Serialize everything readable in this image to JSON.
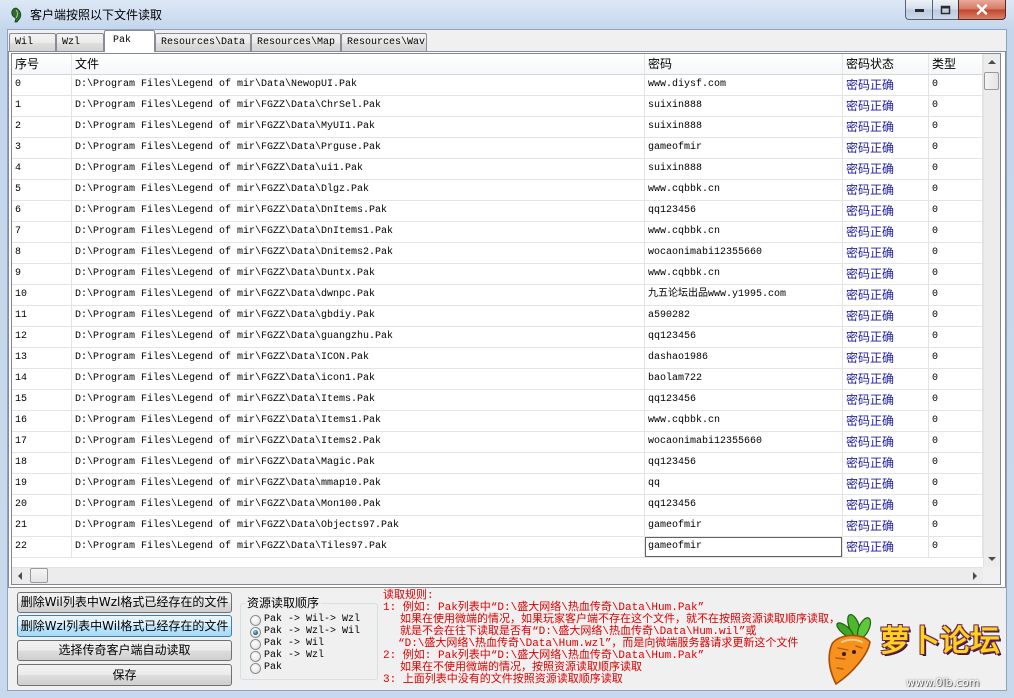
{
  "window": {
    "title": "客户端按照以下文件读取",
    "icons": {
      "app": "app-icon",
      "minimize": "minimize-icon",
      "maximize": "maximize-icon",
      "close": "close-icon"
    }
  },
  "tabs": [
    {
      "label": "Wil",
      "selected": false
    },
    {
      "label": "Wzl",
      "selected": false
    },
    {
      "label": "Pak",
      "selected": true
    },
    {
      "label": "Resources\\Data",
      "selected": false
    },
    {
      "label": "Resources\\Map",
      "selected": false
    },
    {
      "label": "Resources\\Wav",
      "selected": false
    }
  ],
  "table": {
    "columns": [
      "序号",
      "文件",
      "密码",
      "密码状态",
      "类型"
    ],
    "focused_cell": {
      "row": 22,
      "column": "password"
    },
    "rows": [
      {
        "index": "0",
        "file": "D:\\Program Files\\Legend of mir\\Data\\NewopUI.Pak",
        "password": "www.diysf.com",
        "status": "密码正确",
        "type": "0"
      },
      {
        "index": "1",
        "file": "D:\\Program Files\\Legend of mir\\FGZZ\\Data\\ChrSel.Pak",
        "password": "suixin888",
        "status": "密码正确",
        "type": "0"
      },
      {
        "index": "2",
        "file": "D:\\Program Files\\Legend of mir\\FGZZ\\Data\\MyUI1.Pak",
        "password": "suixin888",
        "status": "密码正确",
        "type": "0"
      },
      {
        "index": "3",
        "file": "D:\\Program Files\\Legend of mir\\FGZZ\\Data\\Prguse.Pak",
        "password": "gameofmir",
        "status": "密码正确",
        "type": "0"
      },
      {
        "index": "4",
        "file": "D:\\Program Files\\Legend of mir\\FGZZ\\Data\\ui1.Pak",
        "password": "suixin888",
        "status": "密码正确",
        "type": "0"
      },
      {
        "index": "5",
        "file": "D:\\Program Files\\Legend of mir\\FGZZ\\Data\\Dlgz.Pak",
        "password": "www.cqbbk.cn",
        "status": "密码正确",
        "type": "0"
      },
      {
        "index": "6",
        "file": "D:\\Program Files\\Legend of mir\\FGZZ\\Data\\DnItems.Pak",
        "password": "qq123456",
        "status": "密码正确",
        "type": "0"
      },
      {
        "index": "7",
        "file": "D:\\Program Files\\Legend of mir\\FGZZ\\Data\\DnItems1.Pak",
        "password": "www.cqbbk.cn",
        "status": "密码正确",
        "type": "0"
      },
      {
        "index": "8",
        "file": "D:\\Program Files\\Legend of mir\\FGZZ\\Data\\Dnitems2.Pak",
        "password": "wocaonimabi12355660",
        "status": "密码正确",
        "type": "0"
      },
      {
        "index": "9",
        "file": "D:\\Program Files\\Legend of mir\\FGZZ\\Data\\Duntx.Pak",
        "password": "www.cqbbk.cn",
        "status": "密码正确",
        "type": "0"
      },
      {
        "index": "10",
        "file": "D:\\Program Files\\Legend of mir\\FGZZ\\Data\\dwnpc.Pak",
        "password": "九五论坛出品www.y1995.com",
        "status": "密码正确",
        "type": "0"
      },
      {
        "index": "11",
        "file": "D:\\Program Files\\Legend of mir\\FGZZ\\Data\\gbdiy.Pak",
        "password": "a590282",
        "status": "密码正确",
        "type": "0"
      },
      {
        "index": "12",
        "file": "D:\\Program Files\\Legend of mir\\FGZZ\\Data\\guangzhu.Pak",
        "password": "qq123456",
        "status": "密码正确",
        "type": "0"
      },
      {
        "index": "13",
        "file": "D:\\Program Files\\Legend of mir\\FGZZ\\Data\\ICON.Pak",
        "password": "dashao1986",
        "status": "密码正确",
        "type": "0"
      },
      {
        "index": "14",
        "file": "D:\\Program Files\\Legend of mir\\FGZZ\\Data\\icon1.Pak",
        "password": "baolam722",
        "status": "密码正确",
        "type": "0"
      },
      {
        "index": "15",
        "file": "D:\\Program Files\\Legend of mir\\FGZZ\\Data\\Items.Pak",
        "password": "qq123456",
        "status": "密码正确",
        "type": "0"
      },
      {
        "index": "16",
        "file": "D:\\Program Files\\Legend of mir\\FGZZ\\Data\\Items1.Pak",
        "password": "www.cqbbk.cn",
        "status": "密码正确",
        "type": "0"
      },
      {
        "index": "17",
        "file": "D:\\Program Files\\Legend of mir\\FGZZ\\Data\\Items2.Pak",
        "password": "wocaonimabi12355660",
        "status": "密码正确",
        "type": "0"
      },
      {
        "index": "18",
        "file": "D:\\Program Files\\Legend of mir\\FGZZ\\Data\\Magic.Pak",
        "password": "qq123456",
        "status": "密码正确",
        "type": "0"
      },
      {
        "index": "19",
        "file": "D:\\Program Files\\Legend of mir\\FGZZ\\Data\\mmap10.Pak",
        "password": "qq",
        "status": "密码正确",
        "type": "0"
      },
      {
        "index": "20",
        "file": "D:\\Program Files\\Legend of mir\\FGZZ\\Data\\Mon100.Pak",
        "password": "qq123456",
        "status": "密码正确",
        "type": "0"
      },
      {
        "index": "21",
        "file": "D:\\Program Files\\Legend of mir\\FGZZ\\Data\\Objects97.Pak",
        "password": "gameofmir",
        "status": "密码正确",
        "type": "0"
      },
      {
        "index": "22",
        "file": "D:\\Program Files\\Legend of mir\\FGZZ\\Data\\Tiles97.Pak",
        "password": "gameofmir",
        "status": "密码正确",
        "type": "0"
      }
    ]
  },
  "buttons": {
    "delete_wzl_in_wil": "删除Wil列表中Wzl格式已经存在的文件",
    "delete_wil_in_wzl": "删除Wzl列表中Wil格式已经存在的文件",
    "auto_read": "选择传奇客户端自动读取",
    "save": "保存"
  },
  "read_order": {
    "title": "资源读取顺序",
    "selected_index": 1,
    "options": [
      {
        "label": "Pak -> Wil-> Wzl"
      },
      {
        "label": "Pak -> Wzl-> Wil"
      },
      {
        "label": "Pak -> Wil"
      },
      {
        "label": "Pak -> Wzl"
      },
      {
        "label": "Pak"
      }
    ]
  },
  "rules": {
    "heading": "读取规则:",
    "lines": [
      "1: 例如: Pak列表中“D:\\盛大网络\\热血传奇\\Data\\Hum.Pak”",
      "如果在使用微端的情况，如果玩家客户端不存在这个文件，就不在按照资源读取顺序读取，",
      "就是不会在往下读取是否有“D:\\盛大网络\\热血传奇\\Data\\Hum.wil”或",
      "“D:\\盛大网络\\热血传奇\\Data\\Hum.wzl”，而是向微端服务器请求更新这个文件",
      "2: 例如: Pak列表中“D:\\盛大网络\\热血传奇\\Data\\Hum.Pak”",
      "如果在不使用微端的情况，按照资源读取顺序读取",
      "3: 上面列表中没有的文件按照资源读取顺序读取"
    ]
  },
  "watermark": {
    "logo_text": "萝卜论坛",
    "url": "www.0lb.com",
    "icon": "carrot-icon"
  },
  "colors": {
    "status_text": "#1e1e9e",
    "rules_text": "#e00000",
    "close_button": "#c2452f",
    "hover_button": "#bee6fd"
  }
}
